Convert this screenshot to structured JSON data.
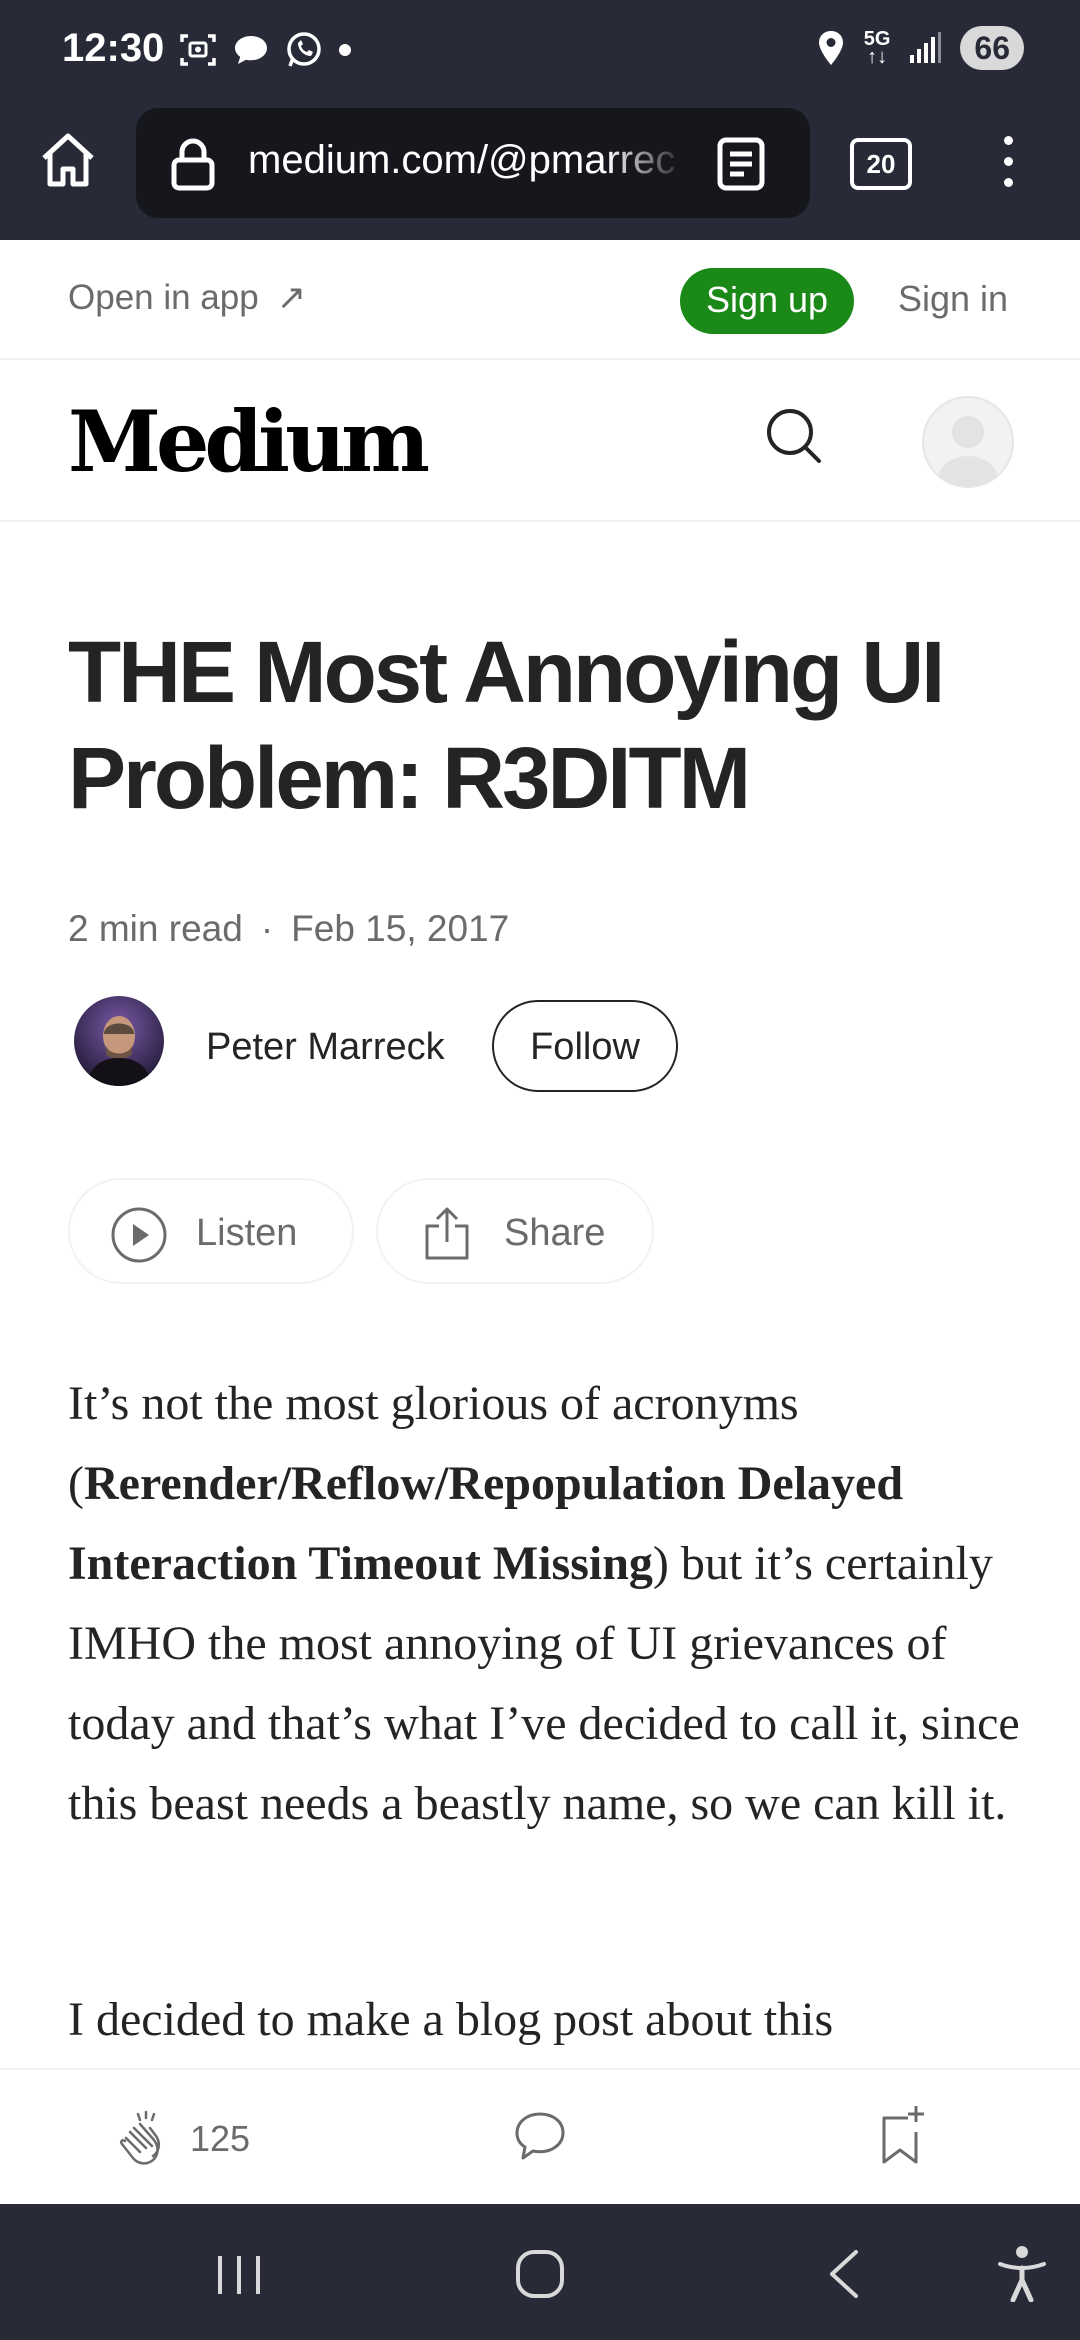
{
  "status_bar": {
    "time": "12:30",
    "network_top": "5G",
    "network_bottom": "↑↓",
    "battery": "66",
    "icons": [
      "screenshot-icon",
      "chat-bubble-icon",
      "whatsapp-icon",
      "dot-icon",
      "location-icon",
      "signal-icon"
    ]
  },
  "browser": {
    "url": "medium.com/@pmarreck",
    "tab_count": "20",
    "icons": [
      "home-icon",
      "lock-icon",
      "reader-mode-icon",
      "menu-dots-icon"
    ]
  },
  "banner": {
    "open_in_app": "Open in app",
    "open_in_app_arrow": "↗",
    "sign_up": "Sign up",
    "sign_in": "Sign in"
  },
  "header": {
    "logo": "Medium"
  },
  "article": {
    "title": "THE Most Annoying UI Problem: R3DITM",
    "read_time": "2 min read",
    "separator": "·",
    "date": "Feb 15, 2017",
    "author": "Peter Marreck",
    "follow": "Follow",
    "listen": "Listen",
    "share": "Share",
    "p1_before": "It’s not the most glorious of acronyms (",
    "p1_bold": "Rerender/Reflow/Repopulation Delayed Interaction Timeout Missing",
    "p1_after": ") but it’s certainly IMHO the most annoying of UI grievances of today and that’s what I’ve decided to call it, since this beast needs a beastly name, so we can kill it.",
    "p2": "I decided to make a blog post about this"
  },
  "actions": {
    "clap_count": "125"
  },
  "colors": {
    "chrome_bg": "#282b37",
    "url_bg": "#16171d",
    "signup_green": "#1a8917",
    "text_primary": "#242424",
    "text_secondary": "#6b6b6b"
  }
}
